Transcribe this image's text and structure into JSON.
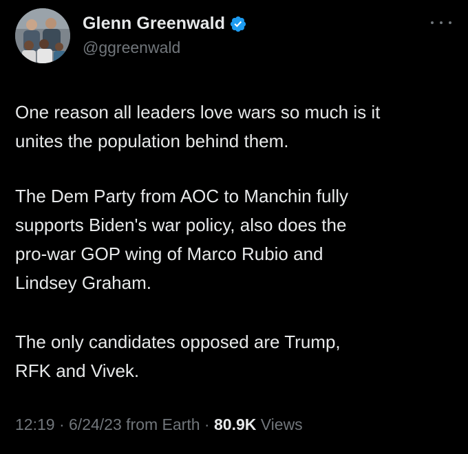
{
  "author": {
    "display_name": "Glenn Greenwald",
    "handle": "@ggreenwald",
    "verified": true,
    "avatar_icon": "profile-photo"
  },
  "tweet": {
    "paragraphs": [
      {
        "lines": [
          "One reason all leaders love wars so much is it",
          "unites the population behind them."
        ]
      },
      {
        "lines": [
          "The Dem Party from AOC to Manchin fully",
          "supports Biden's war policy, also does the",
          "pro-war GOP wing of Marco Rubio and",
          "Lindsey Graham."
        ]
      },
      {
        "lines": [
          "The only candidates opposed are Trump,",
          "RFK and Vivek."
        ]
      }
    ]
  },
  "meta": {
    "time": "12:19",
    "separator": " · ",
    "date": "6/24/23",
    "source": "from Earth",
    "views_count": "80.9K",
    "views_label": "Views"
  },
  "colors": {
    "background": "#000000",
    "text_primary": "#e7e9ea",
    "text_secondary": "#71767b",
    "verified_badge": "#1d9bf0"
  },
  "icons": {
    "verified": "verified-badge-icon",
    "more": "more-options-icon"
  }
}
